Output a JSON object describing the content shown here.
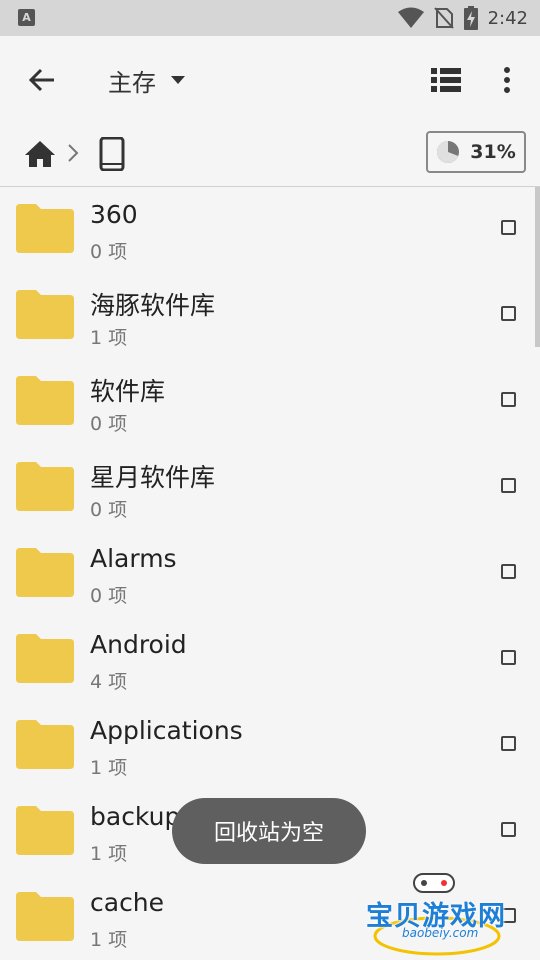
{
  "status_bar": {
    "app_badge": "A",
    "time": "2:42",
    "icons": [
      "wifi-icon",
      "no-sim-icon",
      "battery-charging-icon"
    ]
  },
  "toolbar": {
    "title": "主存",
    "back_icon": "arrow-back-icon",
    "dropdown_icon": "triangle-down-icon",
    "list_view_icon": "list-view-icon",
    "more_icon": "more-vert-icon"
  },
  "path_bar": {
    "home_icon": "home-icon",
    "separator_icon": "chevron-right-icon",
    "device_icon": "phone-icon",
    "storage_usage": "31%",
    "storage_fraction": 0.31
  },
  "files": [
    {
      "name": "360",
      "count": "0 项"
    },
    {
      "name": "海豚软件库",
      "count": "1 项"
    },
    {
      "name": "软件库",
      "count": "0 项"
    },
    {
      "name": "星月软件库",
      "count": "0 项"
    },
    {
      "name": "Alarms",
      "count": "0 项"
    },
    {
      "name": "Android",
      "count": "4 项"
    },
    {
      "name": "Applications",
      "count": "1 项"
    },
    {
      "name": "backups",
      "count": "1 项"
    },
    {
      "name": "cache",
      "count": "1 项"
    }
  ],
  "toast": {
    "message": "回收站为空"
  },
  "watermark": {
    "name": "宝贝游戏网",
    "url": "baobeiy.com"
  },
  "colors": {
    "folder": "#efc94c",
    "accent": "#1d7fd6",
    "toast_bg": "#5f5f5f"
  }
}
